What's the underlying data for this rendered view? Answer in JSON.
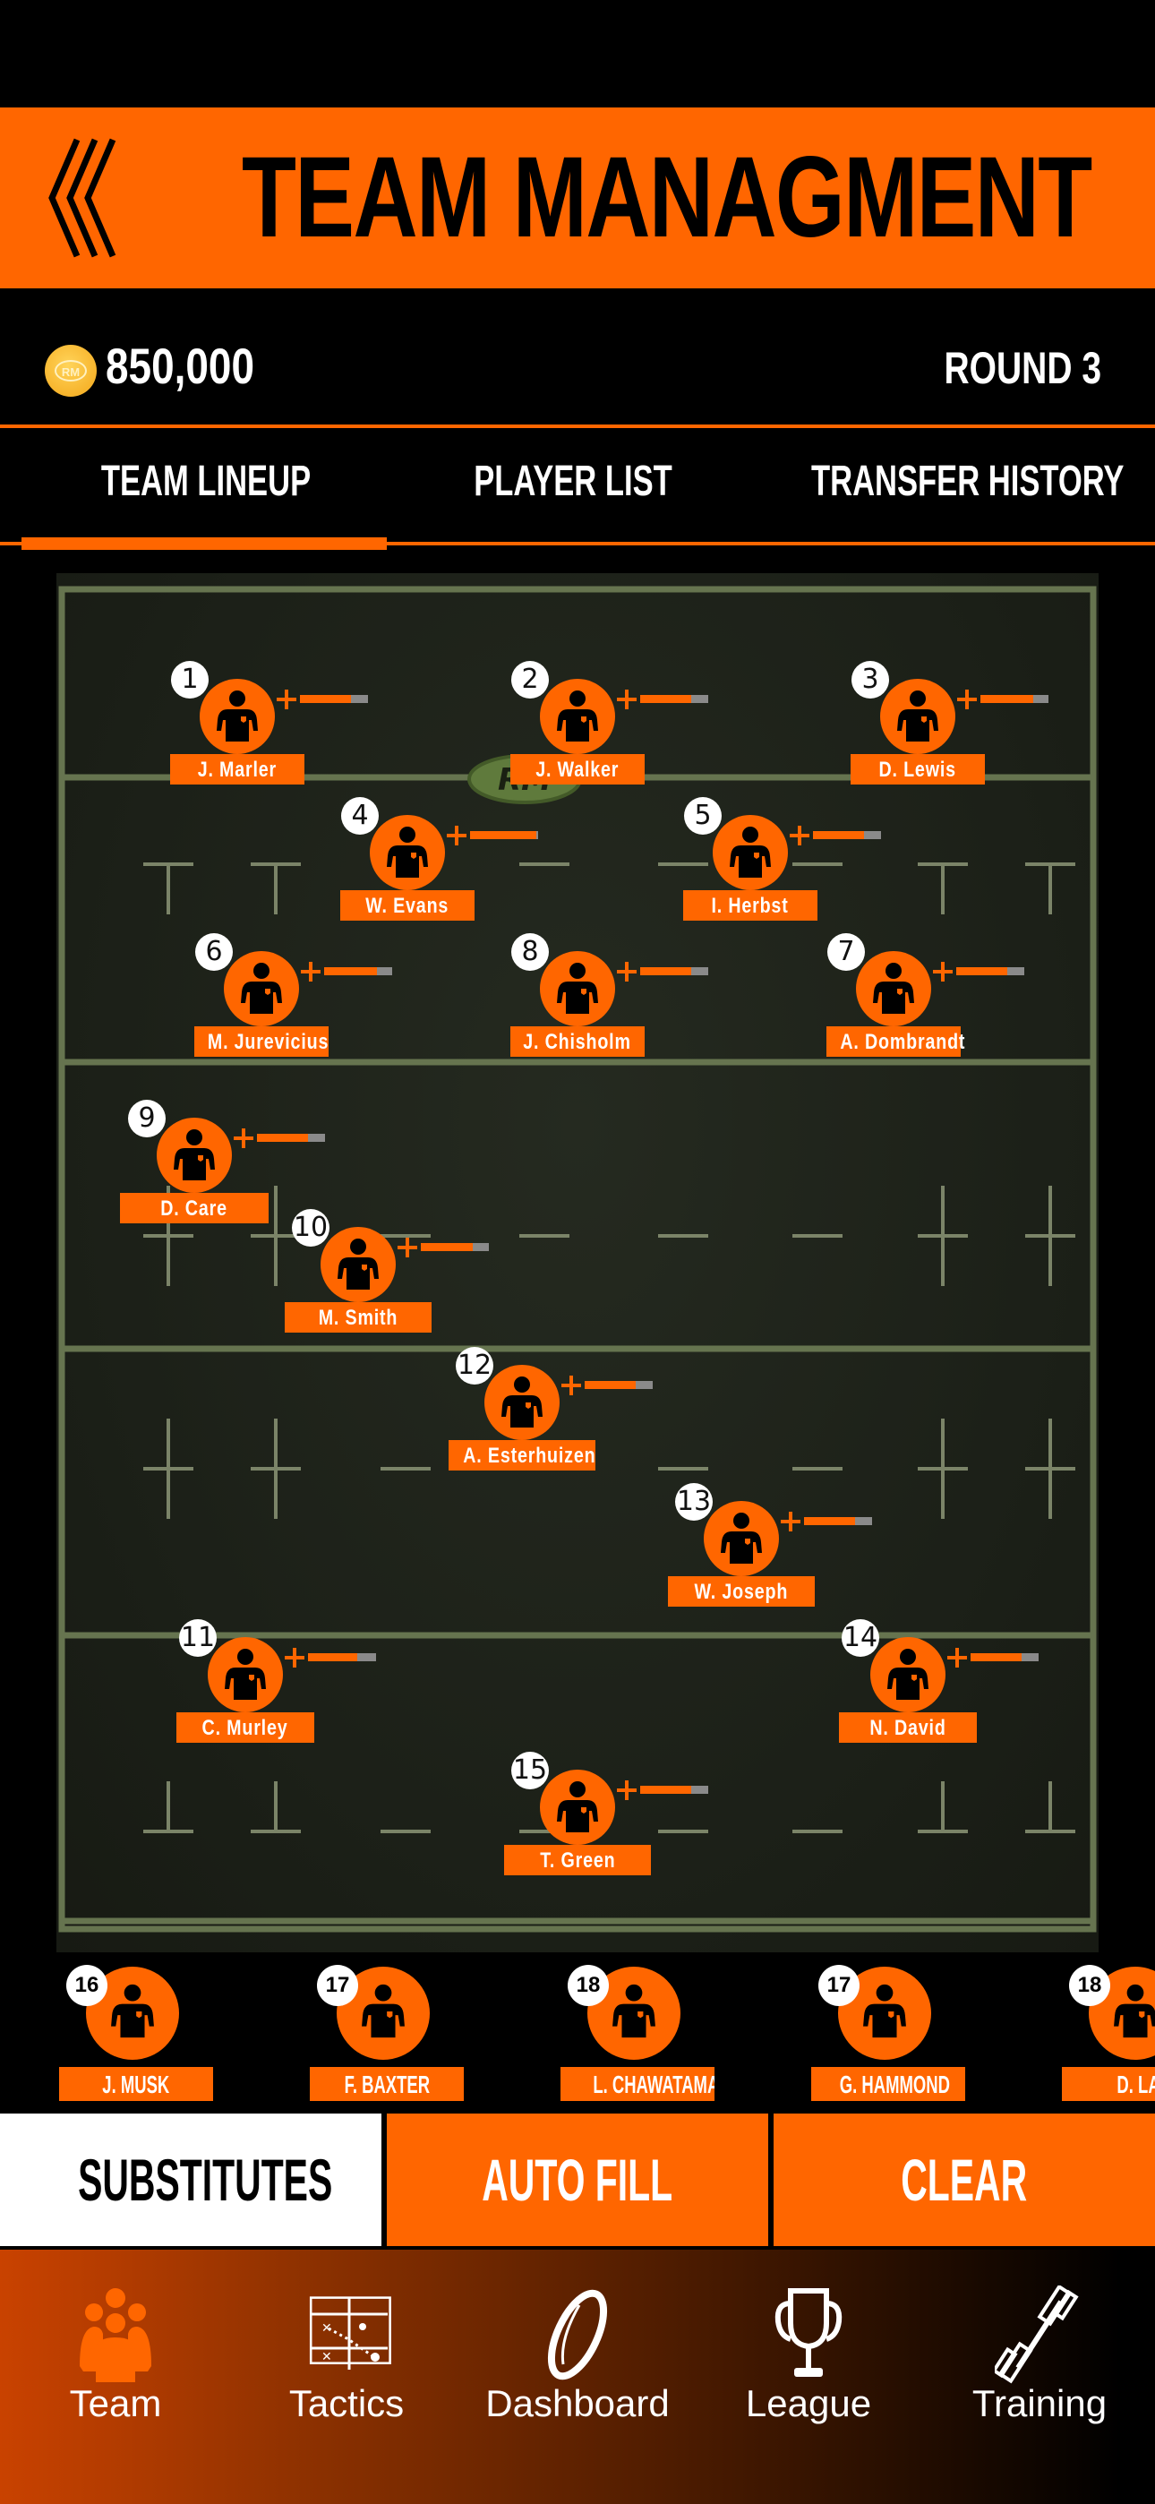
{
  "header": {
    "title": "TEAM MANAGMENT",
    "back_icon": "triple-chevron-left-icon"
  },
  "info": {
    "coins": "850,000",
    "coin_icon_text": "RM",
    "round": "ROUND 3"
  },
  "tabs": [
    {
      "label": "TEAM LINEUP",
      "active": true
    },
    {
      "label": "PLAYER LIST",
      "active": false
    },
    {
      "label": "TRANSFER HISTORY",
      "active": false
    }
  ],
  "field": {
    "logo_text": "RM"
  },
  "lineup": [
    {
      "number": "1",
      "name": "J. Marler",
      "fitness": 0.75
    },
    {
      "number": "2",
      "name": "J. Walker",
      "fitness": 0.75
    },
    {
      "number": "3",
      "name": "D. Lewis",
      "fitness": 0.78
    },
    {
      "number": "4",
      "name": "W. Evans",
      "fitness": 0.97
    },
    {
      "number": "5",
      "name": "I. Herbst",
      "fitness": 0.75
    },
    {
      "number": "6",
      "name": "M. Jurevicius",
      "fitness": 0.78
    },
    {
      "number": "8",
      "name": "J. Chisholm",
      "fitness": 0.75
    },
    {
      "number": "7",
      "name": "A. Dombrandt",
      "fitness": 0.75
    },
    {
      "number": "9",
      "name": "D. Care",
      "fitness": 0.75
    },
    {
      "number": "10",
      "name": "M. Smith",
      "fitness": 0.76
    },
    {
      "number": "12",
      "name": "A. Esterhuizen",
      "fitness": 0.75
    },
    {
      "number": "13",
      "name": "W. Joseph",
      "fitness": 0.75
    },
    {
      "number": "11",
      "name": "C. Murley",
      "fitness": 0.73
    },
    {
      "number": "14",
      "name": "N. David",
      "fitness": 0.75
    },
    {
      "number": "15",
      "name": "T. Green",
      "fitness": 0.75
    }
  ],
  "substitutes": [
    {
      "number": "16",
      "name": "J. MUSK"
    },
    {
      "number": "17",
      "name": "F. BAXTER"
    },
    {
      "number": "18",
      "name": "L. CHAWATAMA"
    },
    {
      "number": "17",
      "name": "G. HAMMOND"
    },
    {
      "number": "18",
      "name": "D. LA"
    }
  ],
  "actions": {
    "substitutes": "SUBSTITUTES",
    "auto_fill": "AUTO FILL",
    "clear": "CLEAR"
  },
  "nav": [
    {
      "label": "Team",
      "icon": "team-icon",
      "active": true
    },
    {
      "label": "Tactics",
      "icon": "tactics-board-icon",
      "active": false
    },
    {
      "label": "Dashboard",
      "icon": "rugby-ball-icon",
      "active": false
    },
    {
      "label": "League",
      "icon": "trophy-icon",
      "active": false
    },
    {
      "label": "Training",
      "icon": "dumbbell-icon",
      "active": false
    }
  ],
  "colors": {
    "accent": "#ff6600",
    "field": "#1d2119",
    "field_lines": "#6b7a55",
    "coin": "#f7b42c"
  }
}
